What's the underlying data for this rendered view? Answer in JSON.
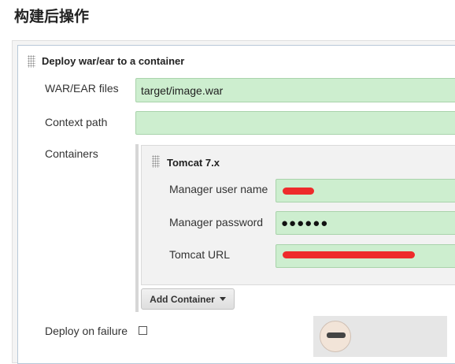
{
  "section": {
    "title": "构建后操作"
  },
  "step": {
    "header": "Deploy war/ear to a container"
  },
  "fields": {
    "war_ear_label": "WAR/EAR files",
    "war_ear_value": "target/image.war",
    "context_path_label": "Context path",
    "context_path_value": "",
    "containers_label": "Containers"
  },
  "container": {
    "title": "Tomcat 7.x",
    "manager_user_label": "Manager user name",
    "manager_password_label": "Manager password",
    "manager_password_value": "●●●●●●",
    "tomcat_url_label": "Tomcat URL"
  },
  "add_container": {
    "label": "Add Container"
  },
  "deploy_on_failure": {
    "label": "Deploy on failure",
    "checked": false
  },
  "colors": {
    "field_bg": "#cdeecf",
    "redaction": "#ee2b2b",
    "step_border": "#b8c8d8"
  }
}
